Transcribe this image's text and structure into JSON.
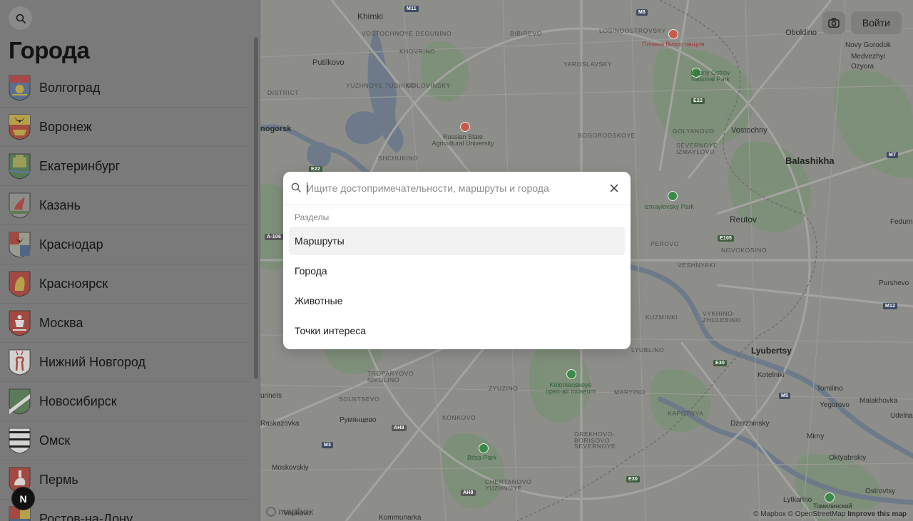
{
  "sidebar": {
    "title": "Города",
    "cities": [
      {
        "name": "Волгоград"
      },
      {
        "name": "Воронеж"
      },
      {
        "name": "Екатеринбург"
      },
      {
        "name": "Казань"
      },
      {
        "name": "Краснодар"
      },
      {
        "name": "Красноярск"
      },
      {
        "name": "Москва"
      },
      {
        "name": "Нижний Новгород"
      },
      {
        "name": "Новосибирск"
      },
      {
        "name": "Омск"
      },
      {
        "name": "Пермь"
      },
      {
        "name": "Ростов-на-Дону"
      }
    ],
    "badge": "N"
  },
  "map": {
    "login_label": "Войти",
    "attribution": {
      "mapbox": "© Mapbox",
      "osm": "© OpenStreetMap",
      "improve": "Improve this map"
    },
    "logo": "mapbox",
    "labels": {
      "khimki": "Khimki",
      "vostochnoye_degunino": "VOSTOCHNOYE DEGUNINO",
      "beskudnikovsky": "BESKUDNIKOVSKY DISTRICT",
      "bibirevo": "BIBIREVO",
      "losinoostrovsky": "LOSINOOSTROVSKY",
      "oboldino": "Oboldino",
      "novy_gorodok": "Novy Gorodok",
      "medvezhyi": "Medvezhyi",
      "ozyora": "Ozyora",
      "khovrino": "KHOVRINO",
      "yaroslavsky": "YAROSLAVSKY",
      "pochta": "Почина Вихостанция",
      "losiny_ostrov": "Losiny Ostrov National Park",
      "putilkovo": "Putilkovo",
      "district": "DISTRICT",
      "yuzhnoye_tushino": "YUZHNOYE TUSHINO",
      "golovinsky": "GOLOVINSKY",
      "rsau": "Russian State Agricultural University",
      "bogorodskoye": "BOGORODSKOYE",
      "golyanovo": "GOLYANOVO",
      "vostochny": "Vostochny",
      "severnoye_izmaylovo": "SEVERNOYE IZMAYLOVO",
      "balashikha": "Balashikha",
      "nogorsk": "nogorsk",
      "shchukino": "SHCHUKINO",
      "izmaylovsky_park": "Izmaylovsky Park",
      "reutov": "Reutov",
      "fedurnovo": "Fedurn",
      "perovo": "PEROVO",
      "novokosino": "NOVOKOSINO",
      "veshnyaki": "VESHNYAKI",
      "purshevo": "Purshevo",
      "kuzminki": "KUZMINKI",
      "vykhino": "VYKHINO-ZHULEBINO",
      "lyublino": "LYUBLINO",
      "lyubertsy": "Lyubertsy",
      "kotelniki": "Kotelniki",
      "tomilino": "Tomilino",
      "yegorovo": "Yegorovo",
      "malakhovka": "Malakhovka",
      "udelnaya": "Udelna",
      "troparyovo": "TROPARYOVO NIKULINO",
      "vnukovo_urinets": "urinets",
      "solntsevo": "SOLNTSEVO",
      "zyuzino": "ZYUZINO",
      "kolomenskoye": "Kolomenskoye open-air museum",
      "maryino": "MARYINO",
      "kapotnya": "KAPOTNYA",
      "dzerzhinsky": "Dzerzhinsky",
      "mirny": "Mirny",
      "oktyabrsky": "Oktyabrskiy",
      "raskazovka": "Raskazovka",
      "rumyantsevo": "Румянцево",
      "konkovo": "KONKOVO",
      "orekhovo": "OREKHOVO-BORISOVO SEVERNOYE",
      "bitsa_park": "Bitsa Park",
      "moskovskiy": "Moskovskiy",
      "chertanovo": "CHERTANOVO YUZHNOYE",
      "lytkarino": "Lytkarino",
      "ostrovtsy": "Ostrovtsy",
      "tomilinsky": "Томилинский",
      "vnukovo": "Vnukovo",
      "kommunarka": "Kommunarka",
      "ryazhki": "Kh"
    },
    "shields": {
      "m11": "M11",
      "m8": "M8",
      "e22a": "E22",
      "e22b": "E22",
      "m7": "M7",
      "e105": "E105",
      "m12": "M12",
      "a106": "A-106",
      "e30a": "E30",
      "m5": "M5",
      "ah8a": "AH8",
      "m3": "M3",
      "ah8b": "AH8",
      "e30b": "E30"
    }
  },
  "search": {
    "placeholder": "Ищите достопримечательности, маршруты и города",
    "section_label": "Разделы",
    "items": [
      {
        "label": "Маршруты"
      },
      {
        "label": "Города"
      },
      {
        "label": "Животные"
      },
      {
        "label": "Точки интереса"
      }
    ]
  }
}
